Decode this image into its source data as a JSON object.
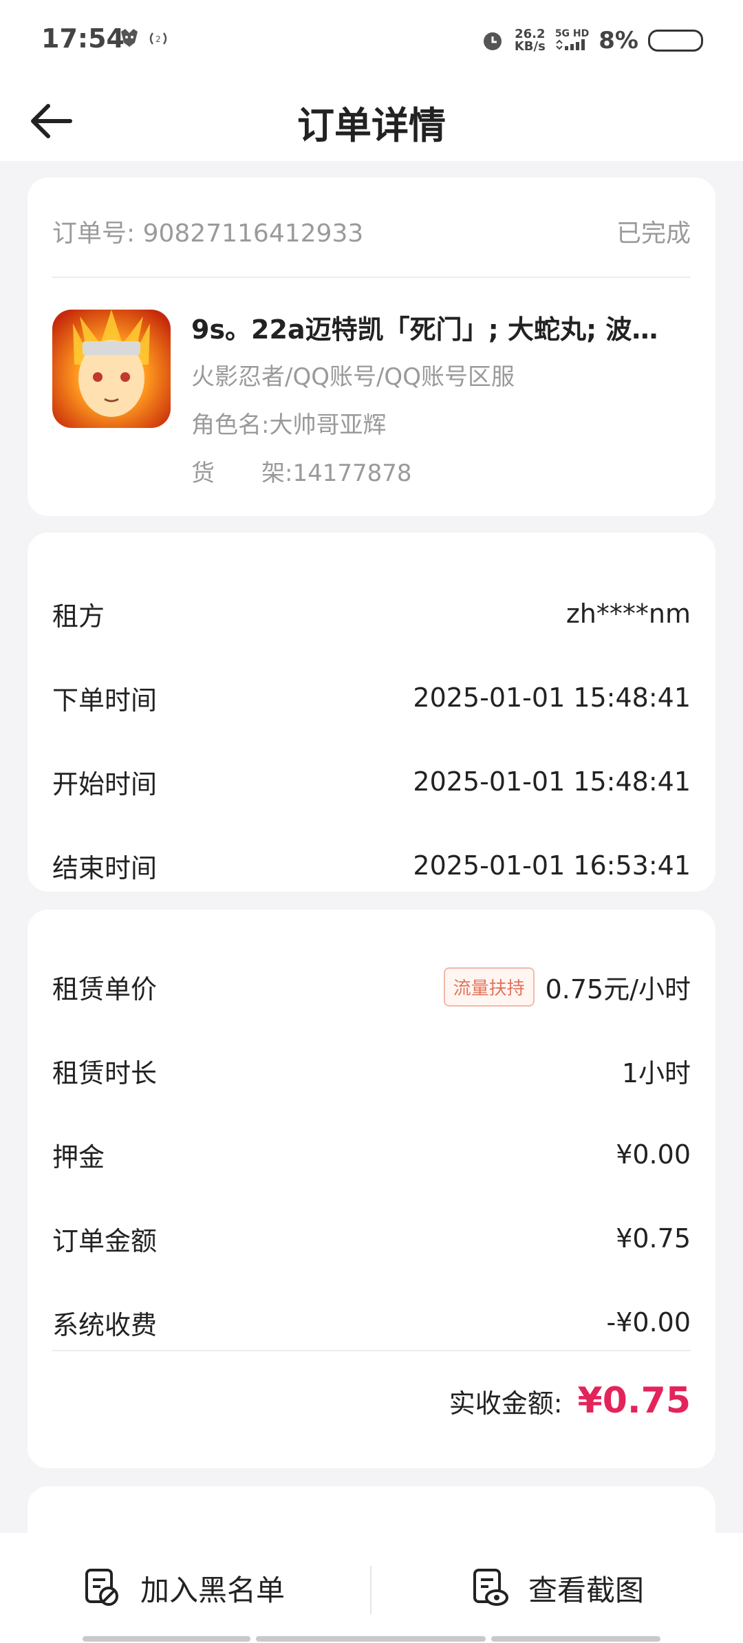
{
  "status_bar": {
    "time": "17:54",
    "speed_top": "26.2",
    "speed_bottom": "KB/s",
    "network": "5G HD",
    "battery": "8%"
  },
  "header": {
    "title": "订单详情"
  },
  "order": {
    "id_label": "订单号:",
    "id_value": "90827116412933",
    "status": "已完成",
    "product_title": "9s。22a迈特凯「死门」; 大蛇丸; 波…",
    "category": "火影忍者/QQ账号/QQ账号区服",
    "role_label": "角色名:",
    "role_value": "大帅哥亚辉",
    "shelf_label": "货　　架:",
    "shelf_value": "14177878"
  },
  "rental": {
    "rows": [
      {
        "label": "租方",
        "value": "zh****nm"
      },
      {
        "label": "下单时间",
        "value": "2025-01-01 15:48:41"
      },
      {
        "label": "开始时间",
        "value": "2025-01-01 15:48:41"
      },
      {
        "label": "结束时间",
        "value": "2025-01-01 16:53:41"
      }
    ]
  },
  "pricing": {
    "unit_price_label": "租赁单价",
    "unit_price_tag": "流量扶持",
    "unit_price_value": "0.75元/小时",
    "duration_label": "租赁时长",
    "duration_value": "1小时",
    "deposit_label": "押金",
    "deposit_value": "¥0.00",
    "amount_label": "订单金额",
    "amount_value": "¥0.75",
    "fee_label": "系统收费",
    "fee_value": "-¥0.00",
    "received_label": "实收金额:",
    "received_value": "¥0.75"
  },
  "actions": {
    "blacklist": "加入黑名单",
    "screenshot": "查看截图"
  },
  "colors": {
    "accent": "#e3245b",
    "tag": "#e3735a"
  }
}
